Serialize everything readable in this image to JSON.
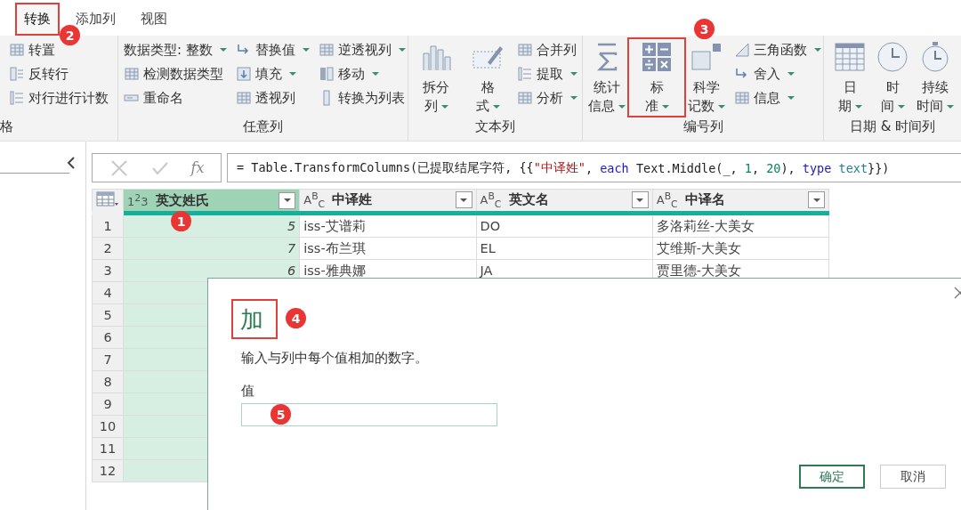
{
  "tabs": [
    {
      "label": "转换",
      "selected": true,
      "highlighted": true,
      "badge": "2"
    },
    {
      "label": "添加列",
      "selected": false,
      "highlighted": false
    },
    {
      "label": "视图",
      "selected": false,
      "highlighted": false
    }
  ],
  "ribbon": {
    "groups": [
      {
        "label": "格",
        "small": [
          [
            {
              "label": "转置",
              "dropdown": false
            },
            {
              "label": "反转行",
              "dropdown": false
            },
            {
              "label": "对行进行计数",
              "dropdown": false
            }
          ]
        ]
      },
      {
        "label": "任意列",
        "small": [
          [
            {
              "label": "数据类型: 整数",
              "dropdown": true
            },
            {
              "label": "检测数据类型",
              "dropdown": false
            },
            {
              "label": "重命名",
              "dropdown": false
            }
          ],
          [
            {
              "label": "替换值",
              "dropdown": true
            },
            {
              "label": "填充",
              "dropdown": true
            },
            {
              "label": "透视列",
              "dropdown": false
            }
          ],
          [
            {
              "label": "逆透视列",
              "dropdown": true
            },
            {
              "label": "移动",
              "dropdown": true
            },
            {
              "label": "转换为列表",
              "dropdown": false
            }
          ]
        ]
      },
      {
        "label": "文本列",
        "large": [
          {
            "lines": [
              "拆分",
              "列"
            ],
            "dropdown": true,
            "highlighted": false
          },
          {
            "lines": [
              "格",
              "式"
            ],
            "dropdown": true,
            "highlighted": false
          }
        ],
        "small": [
          [
            {
              "label": "合并列",
              "dropdown": false
            },
            {
              "label": "提取",
              "dropdown": true
            },
            {
              "label": "分析",
              "dropdown": true
            }
          ]
        ]
      },
      {
        "label": "编号列",
        "large": [
          {
            "lines": [
              "统计",
              "信息"
            ],
            "dropdown": true,
            "highlighted": false
          },
          {
            "lines": [
              "标",
              "准"
            ],
            "dropdown": true,
            "highlighted": true,
            "badge": "3"
          },
          {
            "lines": [
              "科学",
              "记数"
            ],
            "dropdown": true,
            "highlighted": false
          }
        ],
        "small": [
          [
            {
              "label": "三角函数",
              "dropdown": true
            },
            {
              "label": "舍入",
              "dropdown": true
            },
            {
              "label": "信息",
              "dropdown": true
            }
          ]
        ]
      },
      {
        "label": "日期 & 时间列",
        "large": [
          {
            "lines": [
              "日",
              "期"
            ],
            "dropdown": true,
            "highlighted": false
          },
          {
            "lines": [
              "时",
              "间"
            ],
            "dropdown": true,
            "highlighted": false
          },
          {
            "lines": [
              "持续",
              "时间"
            ],
            "dropdown": true,
            "highlighted": false
          }
        ]
      }
    ]
  },
  "formula_bar": {
    "fx_label": "fx",
    "tokens": [
      {
        "kind": "plain",
        "text": "= Table.TransformColumns(已提取结尾字符, {{"
      },
      {
        "kind": "string",
        "text": "\"中译姓\""
      },
      {
        "kind": "plain",
        "text": ", "
      },
      {
        "kind": "keyword",
        "text": "each"
      },
      {
        "kind": "plain",
        "text": " Text.Middle(_, "
      },
      {
        "kind": "number",
        "text": "1"
      },
      {
        "kind": "plain",
        "text": ", "
      },
      {
        "kind": "number",
        "text": "20"
      },
      {
        "kind": "plain",
        "text": "), "
      },
      {
        "kind": "keyword",
        "text": "type "
      },
      {
        "kind": "type",
        "text": "text"
      },
      {
        "kind": "plain",
        "text": "}})"
      }
    ]
  },
  "table": {
    "columns": [
      {
        "type_icon": "1$^{2}$3",
        "name": "英文姓氏",
        "selected": true,
        "badge": "1"
      },
      {
        "type_icon": "A$^{B}$$_{C}$",
        "name": "中译姓",
        "selected": false
      },
      {
        "type_icon": "A$^{B}$$_{C}$",
        "name": "英文名",
        "selected": false
      },
      {
        "type_icon": "A$^{B}$$_{C}$",
        "name": "中译名",
        "selected": false
      }
    ],
    "rows": [
      {
        "number": "1",
        "cells": [
          "5",
          "iss-艾谱莉",
          "DO",
          "多洛莉丝-大美女"
        ]
      },
      {
        "number": "2",
        "cells": [
          "7",
          "iss-布兰琪",
          "EL",
          "艾维斯-大美女"
        ]
      },
      {
        "number": "3",
        "cells": [
          "6",
          "iss-雅典娜",
          "JA",
          "贾里德-大美女"
        ]
      },
      {
        "number": "4"
      },
      {
        "number": "5"
      },
      {
        "number": "6"
      },
      {
        "number": "7"
      },
      {
        "number": "8"
      },
      {
        "number": "9"
      },
      {
        "number": "10"
      },
      {
        "number": "11"
      },
      {
        "number": "12"
      }
    ]
  },
  "dialog": {
    "title": "加",
    "title_highlighted": true,
    "title_badge": "4",
    "description": "输入与列中每个值相加的数字。",
    "field": {
      "label": "值",
      "badge": "5"
    },
    "buttons": [
      {
        "label": "确定",
        "primary": true
      },
      {
        "label": "取消",
        "primary": false
      }
    ]
  }
}
